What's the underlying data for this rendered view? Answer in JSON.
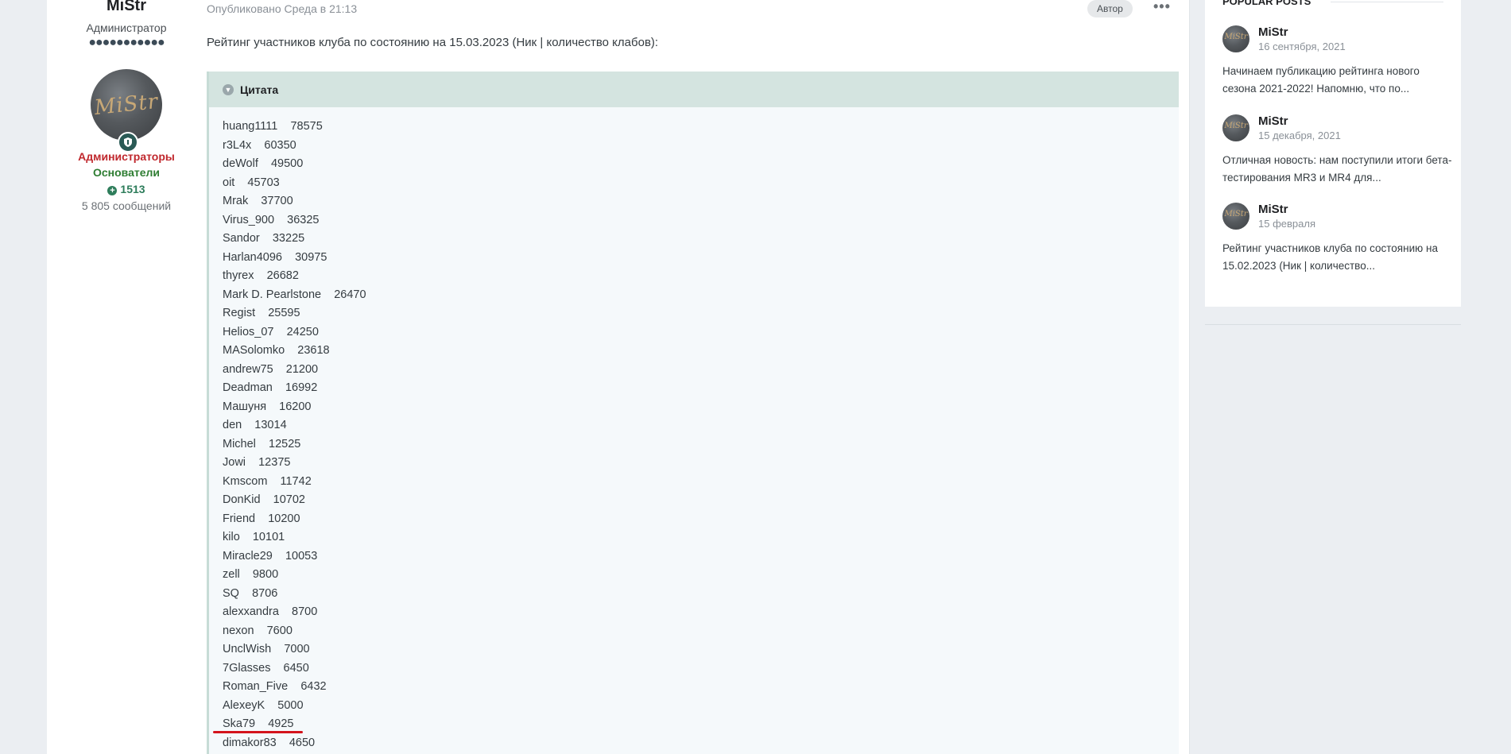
{
  "author": {
    "name": "MiStr",
    "title": "Администратор",
    "pips": "●●●●●●●●●●●",
    "avatar_text": "MiStr",
    "badge_icon": "shield-icon",
    "group_admin": "Администраторы",
    "group_founder": "Основатели",
    "reputation": "1513",
    "post_count": "5 805 сообщений"
  },
  "post": {
    "meta": "Опубликовано Среда в 21:13",
    "author_tag": "Автор",
    "more_icon": "•••",
    "intro": "Рейтинг участников клуба по состоянию на 15.03.2023 (Ник | количество клабов):",
    "quote_label": "Цитата",
    "rankings": [
      "huang1111    78575",
      "r3L4x    60350",
      "deWolf    49500",
      "oit    45703",
      "Mrak    37700",
      "Virus_900    36325",
      "Sandor    33225",
      "Harlan4096    30975",
      "thyrex    26682",
      "Mark D. Pearlstone    26470",
      "Regist    25595",
      "Helios_07    24250",
      "MASolomko    23618",
      "andrew75    21200",
      "Deadman    16992",
      "Машуня    16200",
      "den    13014",
      "Michel    12525",
      "Jowi    12375",
      "Kmscom    11742",
      "DonKid    10702",
      "Friend    10200",
      "kilo    10101",
      "Miracle29    10053",
      "zell    9800",
      "SQ    8706",
      "alexxandra    8700",
      "nexon    7600",
      "UnclWish    7000",
      "7Glasses    6450",
      "Roman_Five    6432",
      "AlexeyK    5000",
      "Ska79    4925",
      "dimakor83    4650"
    ]
  },
  "sidebar": {
    "title": "Popular Posts",
    "items": [
      {
        "name": "MiStr",
        "date": "16 сентября, 2021",
        "excerpt": "Начинаем публикацию рейтинга нового сезона 2021-2022!   Напомню, что по..."
      },
      {
        "name": "MiStr",
        "date": "15 декабря, 2021",
        "excerpt": "Отличная новость: нам поступили итоги бета-тестирования MR3 и MR4 для..."
      },
      {
        "name": "MiStr",
        "date": "15 февраля",
        "excerpt": "Рейтинг участников клуба по состоянию на 15.02.2023 (Ник | количество..."
      }
    ]
  },
  "colors": {
    "accent_underline": "#d4141c",
    "admin_group": "#c0282d",
    "founder_group": "#2e7d32",
    "reputation": "#2e7d5b"
  }
}
